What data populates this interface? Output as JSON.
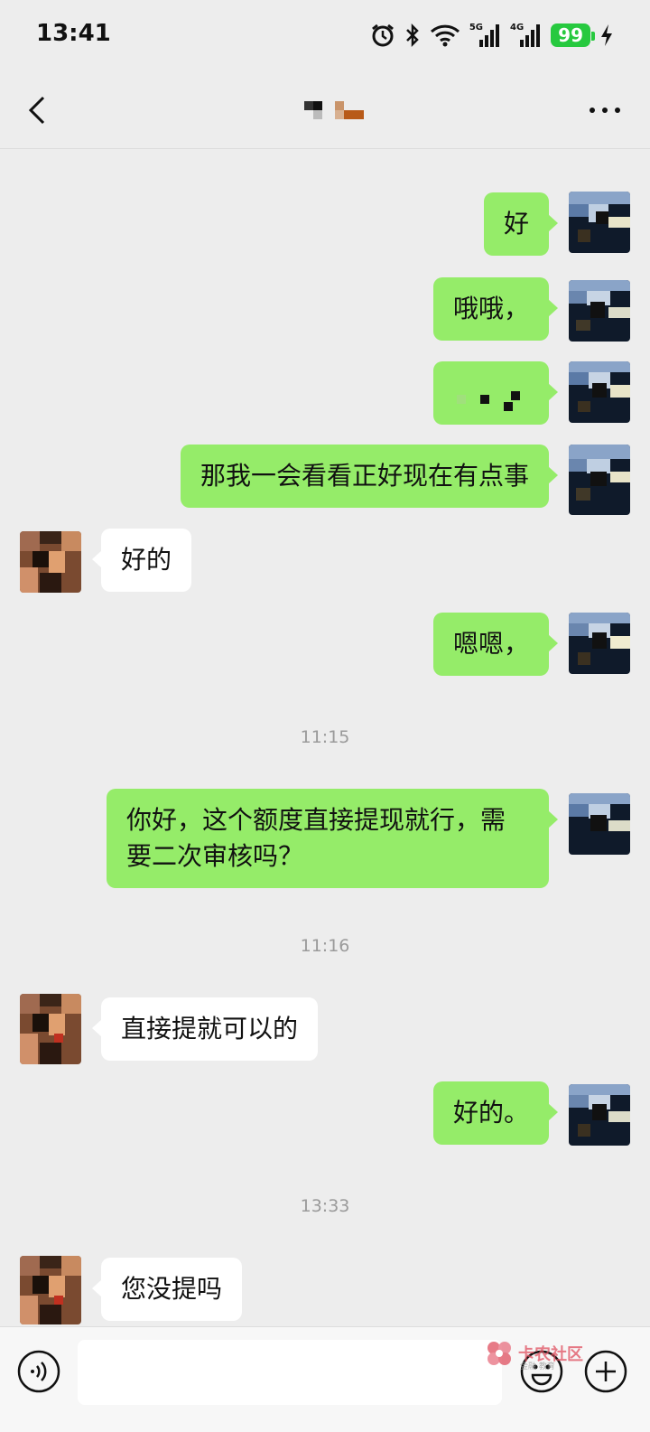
{
  "status_bar": {
    "time": "13:41",
    "net1": "5G",
    "net2": "4G",
    "battery": "99"
  },
  "chat": {
    "timestamps": [
      "11:15",
      "11:16",
      "13:33"
    ],
    "messages": [
      {
        "from": "me",
        "text": "好"
      },
      {
        "from": "me",
        "text": "哦哦，"
      },
      {
        "from": "me",
        "text": ""
      },
      {
        "from": "me",
        "text": "那我一会看看正好现在有点事"
      },
      {
        "from": "other",
        "text": "好的"
      },
      {
        "from": "me",
        "text": "嗯嗯，"
      },
      {
        "from": "me",
        "text": "你好，这个额度直接提现就行，需要二次审核吗？"
      },
      {
        "from": "other",
        "text": "直接提就可以的"
      },
      {
        "from": "me",
        "text": "好的。"
      },
      {
        "from": "other",
        "text": "您没提吗"
      }
    ]
  },
  "input": {
    "value": ""
  },
  "watermark": {
    "text": "卡农社区",
    "sub": "金融 教育"
  },
  "colors": {
    "background": "#ededed",
    "outgoing_bubble": "#95ec69",
    "incoming_bubble": "#ffffff",
    "battery": "#27c93f"
  },
  "icons": [
    "alarm-icon",
    "bluetooth-icon",
    "wifi-icon",
    "signal-icon",
    "battery-icon",
    "charging-icon",
    "back-icon",
    "more-icon",
    "voice-icon",
    "emoji-icon",
    "plus-icon"
  ]
}
